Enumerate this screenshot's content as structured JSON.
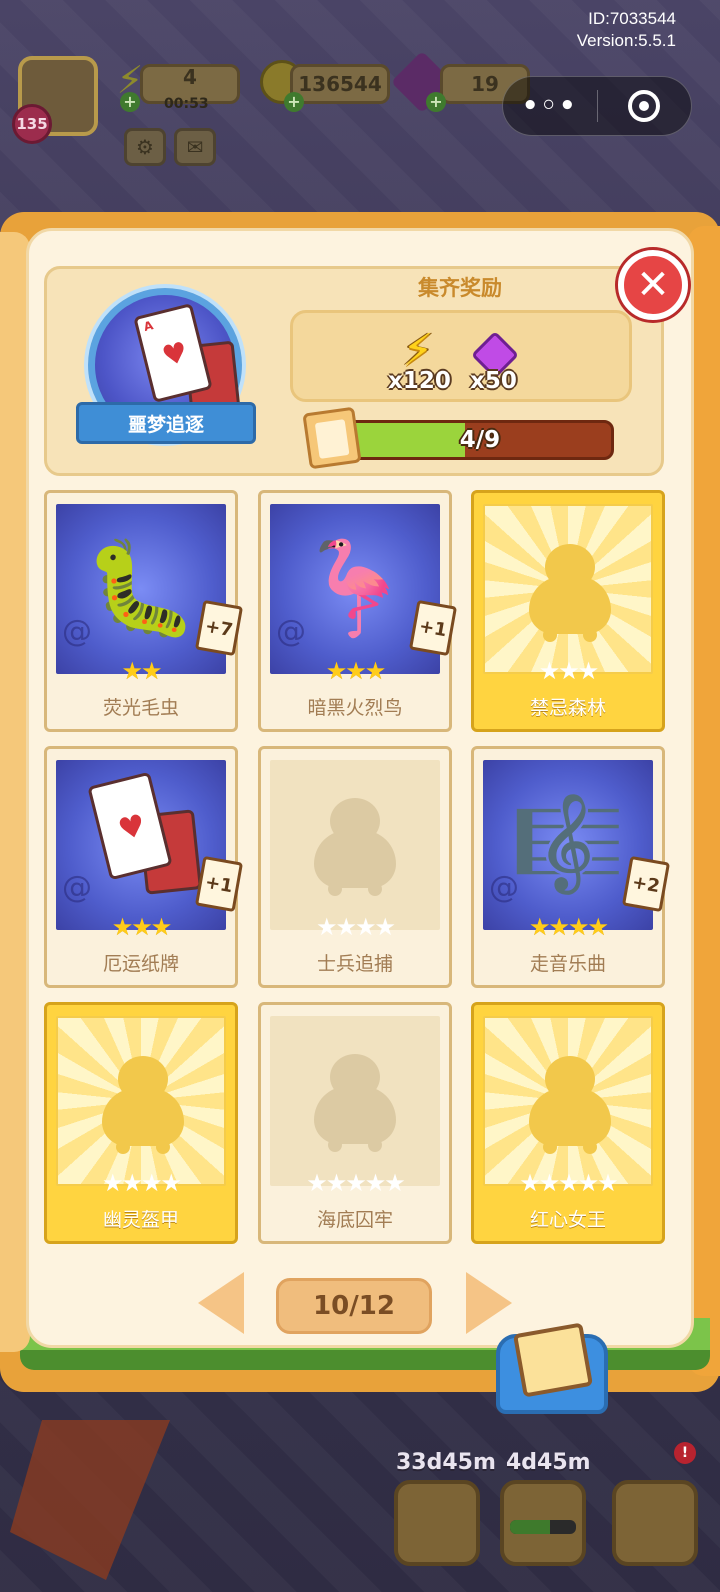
{
  "meta": {
    "id_text": "ID:7033544",
    "version_text": "Version:5.5.1"
  },
  "capsule": {
    "more_label": "•◦•",
    "close_icon": "target-circle-icon"
  },
  "hud": {
    "level": "135",
    "energy": "4",
    "energy_timer": "00:53",
    "coins": "136544",
    "gems": "19"
  },
  "album": {
    "name": "噩梦追逐",
    "reward_title": "集齐奖励",
    "rewards": [
      {
        "icon": "energy-bolt-icon",
        "amount": "x120"
      },
      {
        "icon": "purple-gem-icon",
        "amount": "x50"
      }
    ],
    "progress_text": "4/9",
    "progress_fraction": 0.444
  },
  "cards": [
    {
      "name": "荧光毛虫",
      "state": "owned",
      "stars": 2,
      "max_stars": 2,
      "dup": "+7",
      "art": "🐛"
    },
    {
      "name": "暗黑火烈鸟",
      "state": "owned",
      "stars": 3,
      "max_stars": 3,
      "dup": "+1",
      "art": "🦩"
    },
    {
      "name": "禁忌森林",
      "state": "golden",
      "stars": 0,
      "max_stars": 3,
      "dup": "",
      "art": ""
    },
    {
      "name": "厄运纸牌",
      "state": "owned",
      "stars": 3,
      "max_stars": 3,
      "dup": "+1",
      "art": "cards"
    },
    {
      "name": "士兵追捕",
      "state": "empty",
      "stars": 0,
      "max_stars": 4,
      "dup": "",
      "art": ""
    },
    {
      "name": "走音乐曲",
      "state": "owned",
      "stars": 4,
      "max_stars": 4,
      "dup": "+2",
      "art": "🎼"
    },
    {
      "name": "幽灵盔甲",
      "state": "golden",
      "stars": 0,
      "max_stars": 4,
      "dup": "",
      "art": ""
    },
    {
      "name": "海底囚牢",
      "state": "empty",
      "stars": 0,
      "max_stars": 5,
      "dup": "",
      "art": ""
    },
    {
      "name": "红心女王",
      "state": "golden",
      "stars": 0,
      "max_stars": 5,
      "dup": "",
      "art": ""
    }
  ],
  "pager": {
    "label": "10/12"
  },
  "bottom": {
    "timer_1": "33d45m",
    "timer_2": "4d45m"
  },
  "colors": {
    "accent_orange": "#e8a23a",
    "page_bg": "#fdf3df",
    "close_red": "#e64545",
    "progress_green": "#9bd43c"
  }
}
